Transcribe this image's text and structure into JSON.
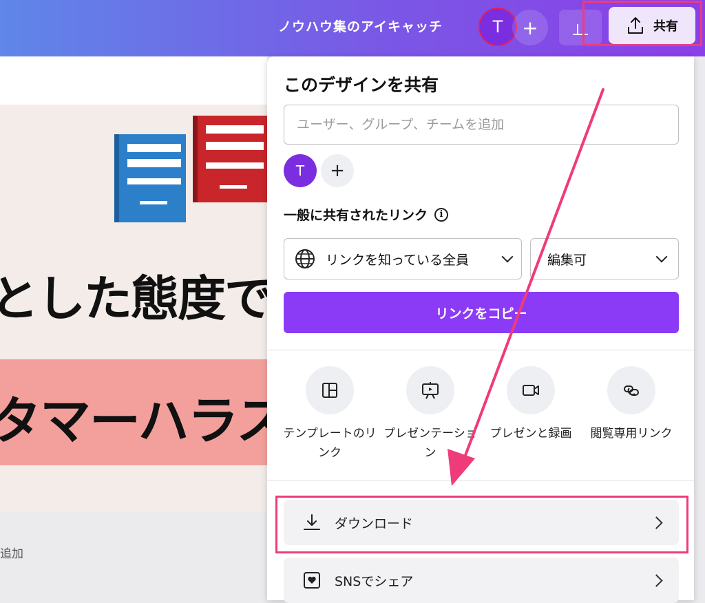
{
  "header": {
    "doc_title": "ノウハウ集のアイキャッチ",
    "avatar_initial": "T",
    "add_label": "+",
    "share_label": "共有"
  },
  "canvas": {
    "headline": "とした態度で",
    "band_text": "タマーハラス",
    "add_text": "追加"
  },
  "share_panel": {
    "title": "このデザインを共有",
    "user_input_placeholder": "ユーザー、グループ、チームを追加",
    "user_input_value": "",
    "member_initial": "T",
    "add_member_label": "+",
    "link_heading": "一般に共有されたリンク",
    "info_label": "i",
    "access_select": "リンクを知っている全員",
    "permission_select": "編集可",
    "copy_link_button": "リンクをコピー",
    "options": [
      {
        "label": "テンプレートのリンク",
        "icon": "template-icon"
      },
      {
        "label": "プレゼンテーション",
        "icon": "presentation-icon"
      },
      {
        "label": "プレゼンと録画",
        "icon": "record-icon"
      },
      {
        "label": "閲覧専用リンク",
        "icon": "link-icon"
      }
    ],
    "download_label": "ダウンロード",
    "sns_label": "SNSでシェア"
  },
  "colors": {
    "accent_purple": "#8b3bf5",
    "highlight_pink": "#ef3b7a",
    "book_blue": "#2c7fc9",
    "book_red": "#c8262b",
    "band_pink": "#f3a09c"
  }
}
